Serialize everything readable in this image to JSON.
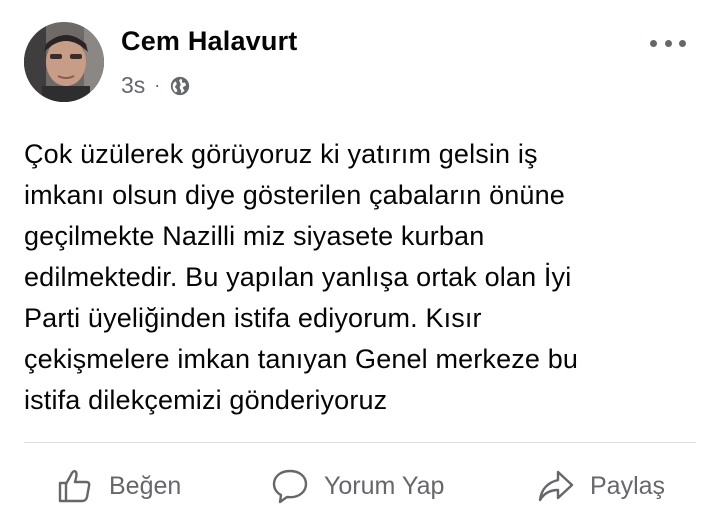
{
  "post": {
    "author": "Cem Halavurt",
    "time": "3s",
    "separator": "·",
    "privacy_icon": "globe-icon",
    "more_icon": "more-options-icon",
    "text": "Çok üzülerek görüyoruz ki yatırım gelsin iş\nimkanı olsun diye gösterilen çabaların önüne\ngeçilmekte Nazilli miz siyasete kurban\nedilmektedir.  Bu yapılan yanlışa ortak olan İyi\nParti üyeliğinden istifa ediyorum.  Kısır\nçekişmelere imkan tanıyan Genel merkeze bu\nistifa dilekçemizi gönderiyoruz"
  },
  "actions": {
    "like_label": "Beğen",
    "comment_label": "Yorum Yap",
    "share_label": "Paylaş"
  },
  "colors": {
    "text_primary": "#050505",
    "text_secondary": "#65676b",
    "divider": "#dadde1"
  }
}
